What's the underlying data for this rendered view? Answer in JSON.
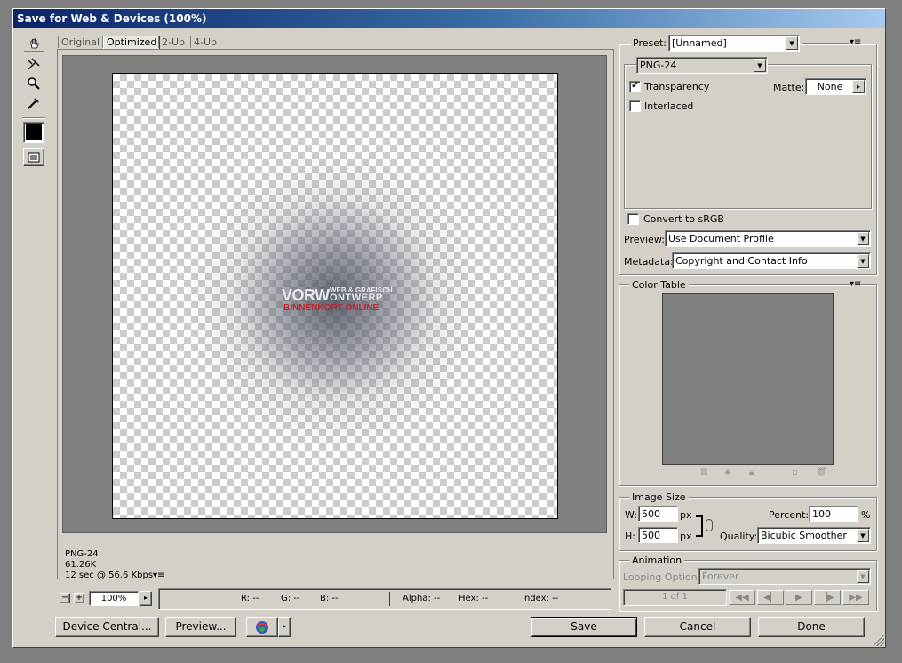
{
  "window": {
    "title": "Save for Web & Devices (100%)"
  },
  "tabs": [
    "Original",
    "Optimized",
    "2-Up",
    "4-Up"
  ],
  "active_tab": "Optimized",
  "image_logo": {
    "line1": "VORW",
    "line2a": "WEB & GRAFISCH",
    "line2b": "ONTWERP",
    "line3": "BINNENKORT ONLINE"
  },
  "info": {
    "format": "PNG-24",
    "size": "61.26K",
    "time": "12 sec @ 56.6 Kbps"
  },
  "status": {
    "zoom": "100%",
    "r": "R: --",
    "g": "G: --",
    "b": "B: --",
    "alpha": "Alpha: --",
    "hex": "Hex: --",
    "index": "Index: --"
  },
  "buttons": {
    "device_central": "Device Central...",
    "preview": "Preview...",
    "save": "Save",
    "cancel": "Cancel",
    "done": "Done"
  },
  "settings": {
    "preset_label": "Preset:",
    "preset_value": "[Unnamed]",
    "format": "PNG-24",
    "transparency_label": "Transparency",
    "transparency_checked": "✔",
    "interlaced_label": "Interlaced",
    "matte_label": "Matte:",
    "matte_value": "None",
    "convert_label": "Convert to sRGB",
    "preview_label": "Preview:",
    "preview_value": "Use Document Profile",
    "metadata_label": "Metadata:",
    "metadata_value": "Copyright and Contact Info"
  },
  "color_table": {
    "title": "Color Table"
  },
  "image_size": {
    "title": "Image Size",
    "w_label": "W:",
    "w_value": "500",
    "h_label": "H:",
    "h_value": "500",
    "unit": "px",
    "percent_label": "Percent:",
    "percent_value": "100",
    "percent_unit": "%",
    "quality_label": "Quality:",
    "quality_value": "Bicubic Smoother"
  },
  "animation": {
    "title": "Animation",
    "looping_label": "Looping Options:",
    "looping_value": "Forever",
    "frame": "1 of 1"
  },
  "colors": {
    "accent_red": "#c0282d",
    "titlebar": "#0a246a"
  }
}
